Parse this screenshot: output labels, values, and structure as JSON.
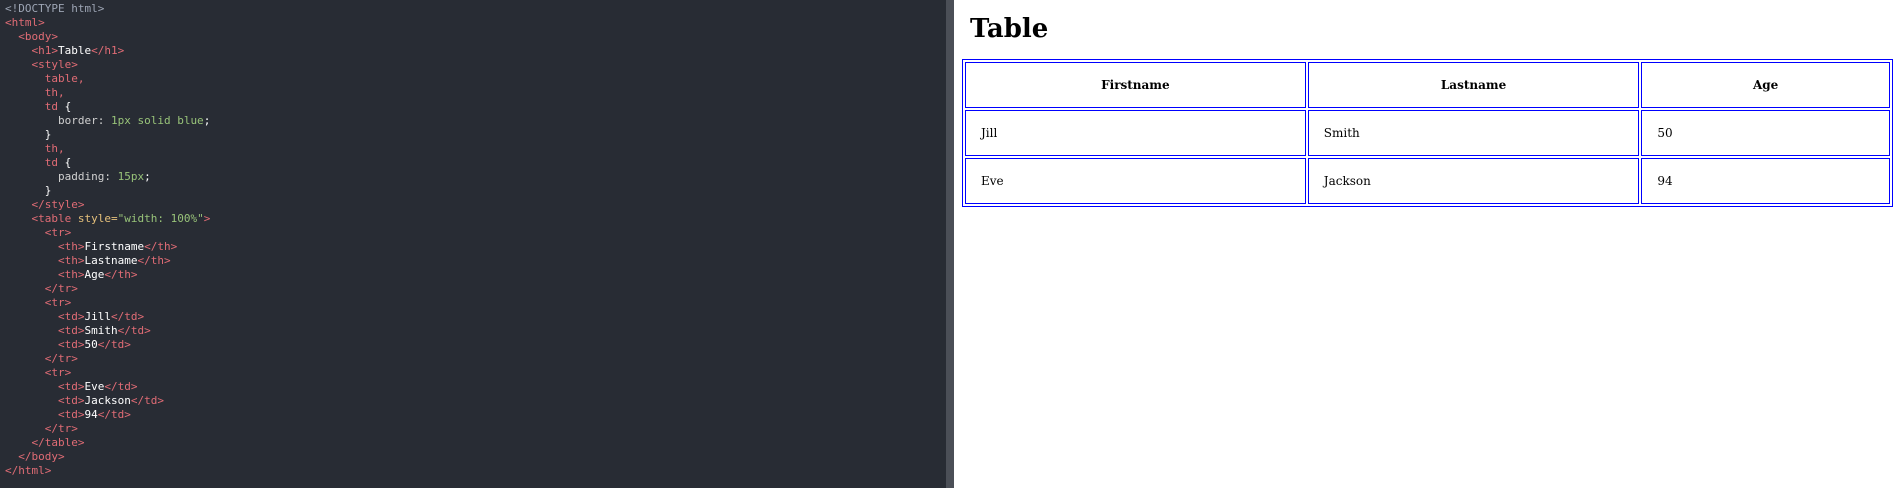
{
  "editor": {
    "lines": [
      [
        {
          "t": "<!DOCTYPE html>",
          "c": "doctype"
        }
      ],
      [
        {
          "t": "<",
          "c": "punct"
        },
        {
          "t": "html",
          "c": "tag"
        },
        {
          "t": ">",
          "c": "punct"
        }
      ],
      [
        {
          "t": "  <",
          "c": "punct"
        },
        {
          "t": "body",
          "c": "tag"
        },
        {
          "t": ">",
          "c": "punct"
        }
      ],
      [
        {
          "t": "    <",
          "c": "punct"
        },
        {
          "t": "h1",
          "c": "tag"
        },
        {
          "t": ">",
          "c": "punct"
        },
        {
          "t": "Table",
          "c": "text"
        },
        {
          "t": "</",
          "c": "punct"
        },
        {
          "t": "h1",
          "c": "tag"
        },
        {
          "t": ">",
          "c": "punct"
        }
      ],
      [
        {
          "t": "    <",
          "c": "punct"
        },
        {
          "t": "style",
          "c": "tag"
        },
        {
          "t": ">",
          "c": "punct"
        }
      ],
      [
        {
          "t": "      table,",
          "c": "sel"
        }
      ],
      [
        {
          "t": "      th,",
          "c": "sel"
        }
      ],
      [
        {
          "t": "      td ",
          "c": "sel"
        },
        {
          "t": "{",
          "c": "brace"
        }
      ],
      [
        {
          "t": "        border: ",
          "c": "prop"
        },
        {
          "t": "1px solid blue",
          "c": "val"
        },
        {
          "t": ";",
          "c": "brace"
        }
      ],
      [
        {
          "t": "      }",
          "c": "brace"
        }
      ],
      [
        {
          "t": "      th,",
          "c": "sel"
        }
      ],
      [
        {
          "t": "      td ",
          "c": "sel"
        },
        {
          "t": "{",
          "c": "brace"
        }
      ],
      [
        {
          "t": "        padding: ",
          "c": "prop"
        },
        {
          "t": "15px",
          "c": "val"
        },
        {
          "t": ";",
          "c": "brace"
        }
      ],
      [
        {
          "t": "      }",
          "c": "brace"
        }
      ],
      [
        {
          "t": "    </",
          "c": "punct"
        },
        {
          "t": "style",
          "c": "tag"
        },
        {
          "t": ">",
          "c": "punct"
        }
      ],
      [
        {
          "t": "    <",
          "c": "punct"
        },
        {
          "t": "table",
          "c": "tag"
        },
        {
          "t": " style=",
          "c": "attr"
        },
        {
          "t": "\"width: 100%\"",
          "c": "str"
        },
        {
          "t": ">",
          "c": "punct"
        }
      ],
      [
        {
          "t": "      <",
          "c": "punct"
        },
        {
          "t": "tr",
          "c": "tag"
        },
        {
          "t": ">",
          "c": "punct"
        }
      ],
      [
        {
          "t": "        <",
          "c": "punct"
        },
        {
          "t": "th",
          "c": "tag"
        },
        {
          "t": ">",
          "c": "punct"
        },
        {
          "t": "Firstname",
          "c": "text"
        },
        {
          "t": "</",
          "c": "punct"
        },
        {
          "t": "th",
          "c": "tag"
        },
        {
          "t": ">",
          "c": "punct"
        }
      ],
      [
        {
          "t": "        <",
          "c": "punct"
        },
        {
          "t": "th",
          "c": "tag"
        },
        {
          "t": ">",
          "c": "punct"
        },
        {
          "t": "Lastname",
          "c": "text"
        },
        {
          "t": "</",
          "c": "punct"
        },
        {
          "t": "th",
          "c": "tag"
        },
        {
          "t": ">",
          "c": "punct"
        }
      ],
      [
        {
          "t": "        <",
          "c": "punct"
        },
        {
          "t": "th",
          "c": "tag"
        },
        {
          "t": ">",
          "c": "punct"
        },
        {
          "t": "Age",
          "c": "text"
        },
        {
          "t": "</",
          "c": "punct"
        },
        {
          "t": "th",
          "c": "tag"
        },
        {
          "t": ">",
          "c": "punct"
        }
      ],
      [
        {
          "t": "      </",
          "c": "punct"
        },
        {
          "t": "tr",
          "c": "tag"
        },
        {
          "t": ">",
          "c": "punct"
        }
      ],
      [
        {
          "t": "      <",
          "c": "punct"
        },
        {
          "t": "tr",
          "c": "tag"
        },
        {
          "t": ">",
          "c": "punct"
        }
      ],
      [
        {
          "t": "        <",
          "c": "punct"
        },
        {
          "t": "td",
          "c": "tag"
        },
        {
          "t": ">",
          "c": "punct"
        },
        {
          "t": "Jill",
          "c": "text"
        },
        {
          "t": "</",
          "c": "punct"
        },
        {
          "t": "td",
          "c": "tag"
        },
        {
          "t": ">",
          "c": "punct"
        }
      ],
      [
        {
          "t": "        <",
          "c": "punct"
        },
        {
          "t": "td",
          "c": "tag"
        },
        {
          "t": ">",
          "c": "punct"
        },
        {
          "t": "Smith",
          "c": "text"
        },
        {
          "t": "</",
          "c": "punct"
        },
        {
          "t": "td",
          "c": "tag"
        },
        {
          "t": ">",
          "c": "punct"
        }
      ],
      [
        {
          "t": "        <",
          "c": "punct"
        },
        {
          "t": "td",
          "c": "tag"
        },
        {
          "t": ">",
          "c": "punct"
        },
        {
          "t": "50",
          "c": "text"
        },
        {
          "t": "</",
          "c": "punct"
        },
        {
          "t": "td",
          "c": "tag"
        },
        {
          "t": ">",
          "c": "punct"
        }
      ],
      [
        {
          "t": "      </",
          "c": "punct"
        },
        {
          "t": "tr",
          "c": "tag"
        },
        {
          "t": ">",
          "c": "punct"
        }
      ],
      [
        {
          "t": "      <",
          "c": "punct"
        },
        {
          "t": "tr",
          "c": "tag"
        },
        {
          "t": ">",
          "c": "punct"
        }
      ],
      [
        {
          "t": "        <",
          "c": "punct"
        },
        {
          "t": "td",
          "c": "tag"
        },
        {
          "t": ">",
          "c": "punct"
        },
        {
          "t": "Eve",
          "c": "text"
        },
        {
          "t": "</",
          "c": "punct"
        },
        {
          "t": "td",
          "c": "tag"
        },
        {
          "t": ">",
          "c": "punct"
        }
      ],
      [
        {
          "t": "        <",
          "c": "punct"
        },
        {
          "t": "td",
          "c": "tag"
        },
        {
          "t": ">",
          "c": "punct"
        },
        {
          "t": "Jackson",
          "c": "text"
        },
        {
          "t": "</",
          "c": "punct"
        },
        {
          "t": "td",
          "c": "tag"
        },
        {
          "t": ">",
          "c": "punct"
        }
      ],
      [
        {
          "t": "        <",
          "c": "punct"
        },
        {
          "t": "td",
          "c": "tag"
        },
        {
          "t": ">",
          "c": "punct"
        },
        {
          "t": "94",
          "c": "text"
        },
        {
          "t": "</",
          "c": "punct"
        },
        {
          "t": "td",
          "c": "tag"
        },
        {
          "t": ">",
          "c": "punct"
        }
      ],
      [
        {
          "t": "      </",
          "c": "punct"
        },
        {
          "t": "tr",
          "c": "tag"
        },
        {
          "t": ">",
          "c": "punct"
        }
      ],
      [
        {
          "t": "    </",
          "c": "punct"
        },
        {
          "t": "table",
          "c": "tag"
        },
        {
          "t": ">",
          "c": "punct"
        }
      ],
      [
        {
          "t": "  </",
          "c": "punct"
        },
        {
          "t": "body",
          "c": "tag"
        },
        {
          "t": ">",
          "c": "punct"
        }
      ],
      [
        {
          "t": "</",
          "c": "punct"
        },
        {
          "t": "html",
          "c": "tag"
        },
        {
          "t": ">",
          "c": "punct"
        }
      ]
    ]
  },
  "preview": {
    "heading": "Table",
    "table": {
      "headers": [
        "Firstname",
        "Lastname",
        "Age"
      ],
      "rows": [
        [
          "Jill",
          "Smith",
          "50"
        ],
        [
          "Eve",
          "Jackson",
          "94"
        ]
      ]
    }
  },
  "colors": {
    "editor_background": "#282c34",
    "tag": "#e06c75",
    "value": "#98c379",
    "table_border": "blue"
  }
}
